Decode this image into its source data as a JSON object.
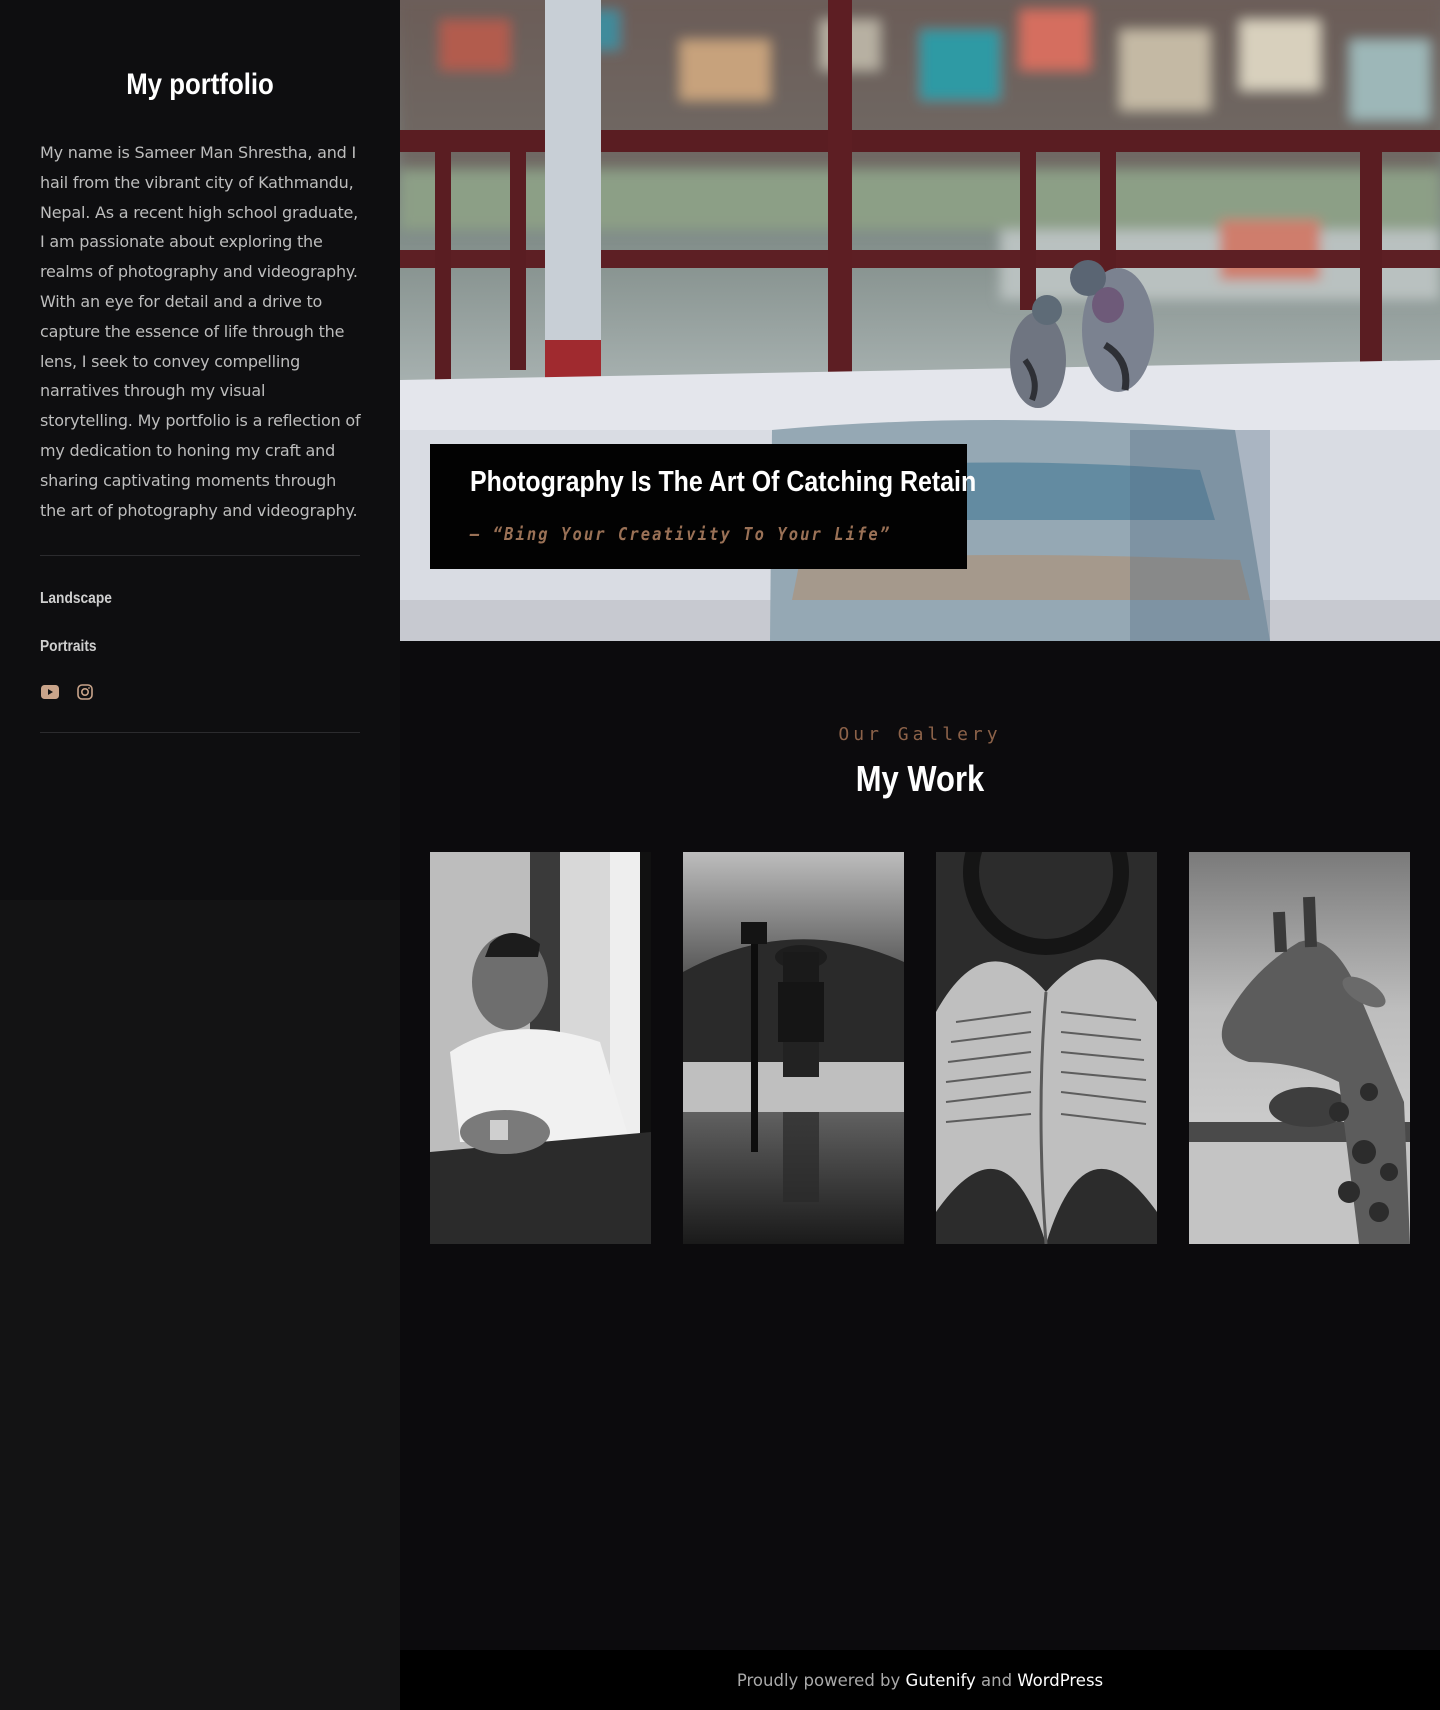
{
  "sidebar": {
    "site_title": "My portfolio",
    "bio": "My name is Sameer Man Shrestha, and I hail from the vibrant city of Kathmandu, Nepal. As a recent high school graduate, I am passionate about exploring the realms of photography and videography. With an eye for detail and a drive to capture the essence of life through the lens, I seek to convey compelling narratives through my visual storytelling. My portfolio is a reflection of my dedication to honing my craft and sharing captivating moments through the art of photography and videography.",
    "nav": [
      {
        "label": "Landscape"
      },
      {
        "label": "Portraits"
      }
    ],
    "social": [
      {
        "icon": "youtube-icon"
      },
      {
        "icon": "instagram-icon"
      }
    ]
  },
  "hero": {
    "title": "Photography Is The Art Of Catching Retain",
    "subtitle": "– “Bing Your Creativity To Your Life”"
  },
  "gallery": {
    "kicker": "Our Gallery",
    "title": "My Work",
    "items": [
      {
        "subject": "portrait-photo"
      },
      {
        "subject": "lego-firefighter-photo"
      },
      {
        "subject": "book-heart-photo"
      },
      {
        "subject": "giraffe-photo"
      }
    ]
  },
  "footer": {
    "prefix": "Proudly powered by ",
    "link1": "Gutenify",
    "middle": " and ",
    "link2": "WordPress"
  },
  "colors": {
    "background": "#0c0b0d",
    "sidebar": "#0e0e10",
    "accent": "#9a7156",
    "social_icon": "#c9a48a"
  }
}
